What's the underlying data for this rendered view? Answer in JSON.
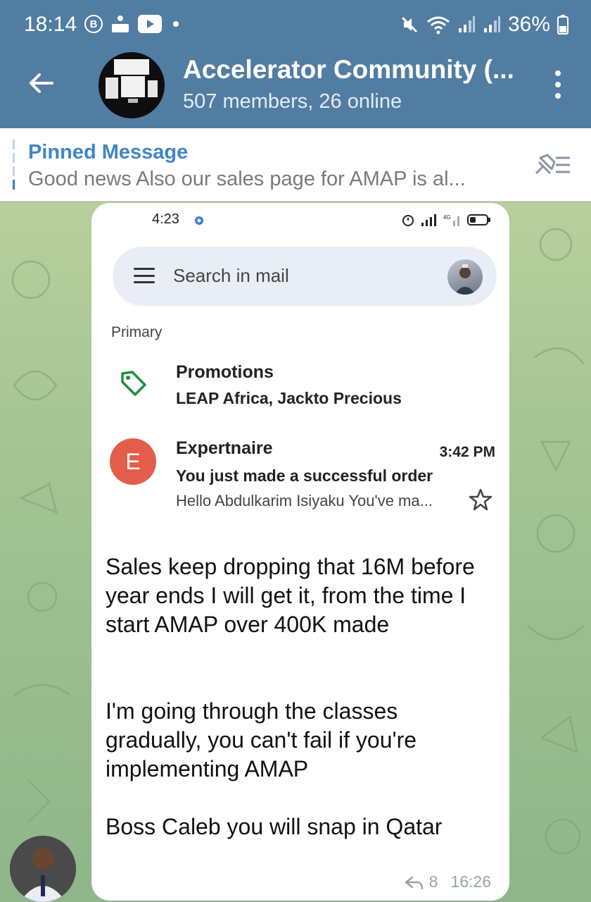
{
  "status_bar": {
    "time": "18:14",
    "left_icons": [
      "b-circle-icon",
      "hotspot-icon",
      "youtube-icon",
      "dot-icon"
    ],
    "right_icons": [
      "mute-icon",
      "wifi-icon",
      "signal-icon",
      "signal-icon"
    ],
    "battery": "36%"
  },
  "header": {
    "title": "Accelerator Community (...",
    "subtitle": "507 members, 26 online"
  },
  "pinned": {
    "title": "Pinned Message",
    "text": "Good news  Also our sales page for AMAP  is al..."
  },
  "message": {
    "screenshot": {
      "time": "4:23",
      "search_placeholder": "Search in mail",
      "section": "Primary",
      "promotions": {
        "title": "Promotions",
        "senders": "LEAP Africa, Jackto Precious"
      },
      "email": {
        "avatar_letter": "E",
        "sender": "Expertnaire",
        "time": "3:42 PM",
        "subject": "You just made a successful order",
        "snippet": "Hello Abdulkarim Isiyaku You've ma..."
      }
    },
    "text": "Sales keep dropping that 16M before year ends I will get it, from the time I start AMAP over 400K made\n\n\nI'm going through the classes gradually, you can't fail if you're implementing AMAP\n\nBoss Caleb you will snap in Qatar",
    "reply_count": "8",
    "time": "16:26"
  },
  "colors": {
    "header_bg": "#527da3",
    "link": "#3f86c7",
    "gmail_avatar": "#e35d4b",
    "tag_green": "#1e8e3e"
  }
}
